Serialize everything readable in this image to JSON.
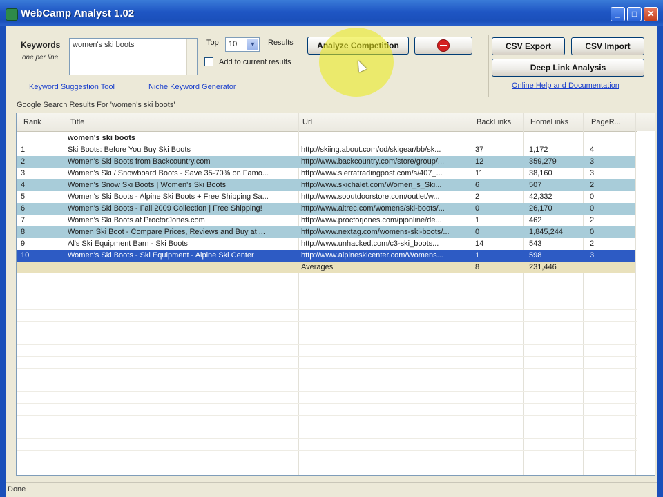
{
  "window": {
    "title": "WebCamp Analyst 1.02",
    "controls": {
      "minimize": "_",
      "maximize": "□",
      "close": "✕"
    }
  },
  "search": {
    "keywords_label": "Keywords",
    "one_per_line": "one per line",
    "keywords_value": "women's ski boots",
    "top_label": "Top",
    "top_value": "10",
    "results_label": "Results",
    "add_to_current": "Add to current results",
    "add_checked": false
  },
  "buttons": {
    "analyze": "Analyze Competition",
    "csv_export": "CSV Export",
    "csv_import": "CSV Import",
    "deep_link": "Deep Link Analysis"
  },
  "links": {
    "keyword_suggestion": "Keyword Suggestion Tool",
    "niche_generator": "Niche Keyword Generator",
    "online_help": "Online Help and Documentation"
  },
  "results_caption": "Google Search Results For 'women's ski boots'",
  "table": {
    "columns": [
      "Rank",
      "Title",
      "Url",
      "BackLinks",
      "HomeLinks",
      "PageR..."
    ],
    "group_label": "women's ski boots",
    "rows": [
      {
        "rank": "1",
        "title": "Ski Boots: Before You Buy Ski Boots",
        "url": "http://skiing.about.com/od/skigear/bb/sk...",
        "backlinks": "37",
        "homelinks": "1,172",
        "pr": "4"
      },
      {
        "rank": "2",
        "title": "Women's Ski Boots from Backcountry.com",
        "url": "http://www.backcountry.com/store/group/...",
        "backlinks": "12",
        "homelinks": "359,279",
        "pr": "3"
      },
      {
        "rank": "3",
        "title": "Women's Ski / Snowboard Boots - Save 35-70% on Famo...",
        "url": "http://www.sierratradingpost.com/s/407_...",
        "backlinks": "11",
        "homelinks": "38,160",
        "pr": "3"
      },
      {
        "rank": "4",
        "title": "Women's Snow Ski Boots | Women's Ski Boots",
        "url": "http://www.skichalet.com/Women_s_Ski...",
        "backlinks": "6",
        "homelinks": "507",
        "pr": "2"
      },
      {
        "rank": "5",
        "title": "Women's Ski Boots - Alpine Ski Boots + Free Shipping Sa...",
        "url": "http://www.sooutdoorstore.com/outlet/w...",
        "backlinks": "2",
        "homelinks": "42,332",
        "pr": "0"
      },
      {
        "rank": "6",
        "title": "Women's Ski Boots - Fall 2009 Collection | Free Shipping!",
        "url": "http://www.altrec.com/womens/ski-boots/...",
        "backlinks": "0",
        "homelinks": "26,170",
        "pr": "0"
      },
      {
        "rank": "7",
        "title": "Women's Ski Boots at ProctorJones.com",
        "url": "http://www.proctorjones.com/pjonline/de...",
        "backlinks": "1",
        "homelinks": "462",
        "pr": "2"
      },
      {
        "rank": "8",
        "title": "Women Ski Boot - Compare Prices, Reviews and Buy at ...",
        "url": "http://www.nextag.com/womens-ski-boots/...",
        "backlinks": "0",
        "homelinks": "1,845,244",
        "pr": "0"
      },
      {
        "rank": "9",
        "title": "Al's Ski Equipment Barn - Ski Boots",
        "url": "http://www.unhacked.com/c3-ski_boots...",
        "backlinks": "14",
        "homelinks": "543",
        "pr": "2"
      },
      {
        "rank": "10",
        "title": "Women's Ski Boots - Ski Equipment - Alpine Ski Center",
        "url": "http://www.alpineskicenter.com/Womens...",
        "backlinks": "1",
        "homelinks": "598",
        "pr": "3"
      }
    ],
    "averages": {
      "label": "Averages",
      "backlinks": "8",
      "homelinks": "231,446"
    }
  },
  "status": "Done"
}
